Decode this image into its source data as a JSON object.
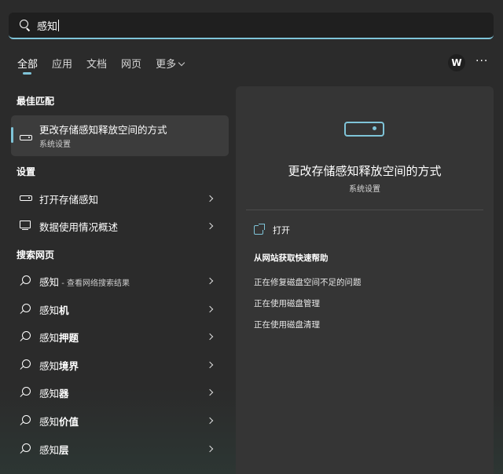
{
  "search": {
    "value": "感知",
    "icon": "search-icon"
  },
  "tabs": [
    {
      "label": "全部",
      "active": true
    },
    {
      "label": "应用"
    },
    {
      "label": "文档"
    },
    {
      "label": "网页"
    },
    {
      "label": "更多"
    }
  ],
  "header": {
    "avatar_letter": "W",
    "more_glyph": "···"
  },
  "best_match": {
    "section": "最佳匹配",
    "title": "更改存储感知释放空间的方式",
    "subtitle": "系统设置",
    "icon": "drive-icon"
  },
  "settings": {
    "section": "设置",
    "items": [
      {
        "label": "打开存储感知",
        "icon": "drive-icon"
      },
      {
        "label": "数据使用情况概述",
        "icon": "monitor-icon"
      }
    ]
  },
  "web": {
    "section": "搜索网页",
    "items": [
      {
        "prefix": "感知",
        "bold": "",
        "sub": " - 查看网络搜索结果"
      },
      {
        "prefix": "感知",
        "bold": "机",
        "sub": ""
      },
      {
        "prefix": "感知",
        "bold": "押题",
        "sub": ""
      },
      {
        "prefix": "感知",
        "bold": "境界",
        "sub": ""
      },
      {
        "prefix": "感知",
        "bold": "器",
        "sub": ""
      },
      {
        "prefix": "感知",
        "bold": "价值",
        "sub": ""
      },
      {
        "prefix": "感知",
        "bold": "层",
        "sub": ""
      }
    ]
  },
  "detail": {
    "title": "更改存储感知释放空间的方式",
    "subtitle": "系统设置",
    "open_label": "打开",
    "help_title": "从网站获取快速帮助",
    "help_links": [
      "正在修复磁盘空间不足的问题",
      "正在使用磁盘管理",
      "正在使用磁盘清理"
    ]
  },
  "colors": {
    "accent": "#7fc4d8",
    "background": "#2b2b2b",
    "panel": "#353535"
  }
}
